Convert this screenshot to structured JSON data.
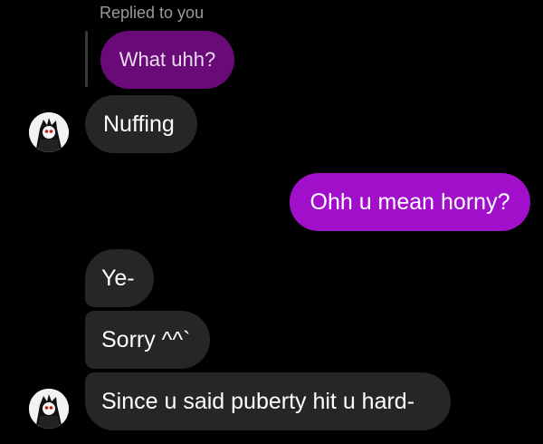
{
  "reply": {
    "label": "Replied to you",
    "quoted_text": "What uhh?"
  },
  "messages": [
    {
      "direction": "incoming",
      "text": "Nuffing"
    },
    {
      "direction": "outgoing",
      "text": "Ohh u mean horny?"
    },
    {
      "direction": "incoming",
      "text": "Ye-"
    },
    {
      "direction": "incoming",
      "text": "Sorry ^^`"
    },
    {
      "direction": "incoming",
      "text": "Since u said puberty hit u hard-"
    }
  ],
  "colors": {
    "background": "#000000",
    "incoming_bubble": "#262626",
    "outgoing_bubble": "#a10fcb",
    "quoted_bubble": "#6a0a78",
    "reply_label": "#9a9a9a"
  },
  "icons": {
    "avatar": "sender-avatar-icon"
  }
}
